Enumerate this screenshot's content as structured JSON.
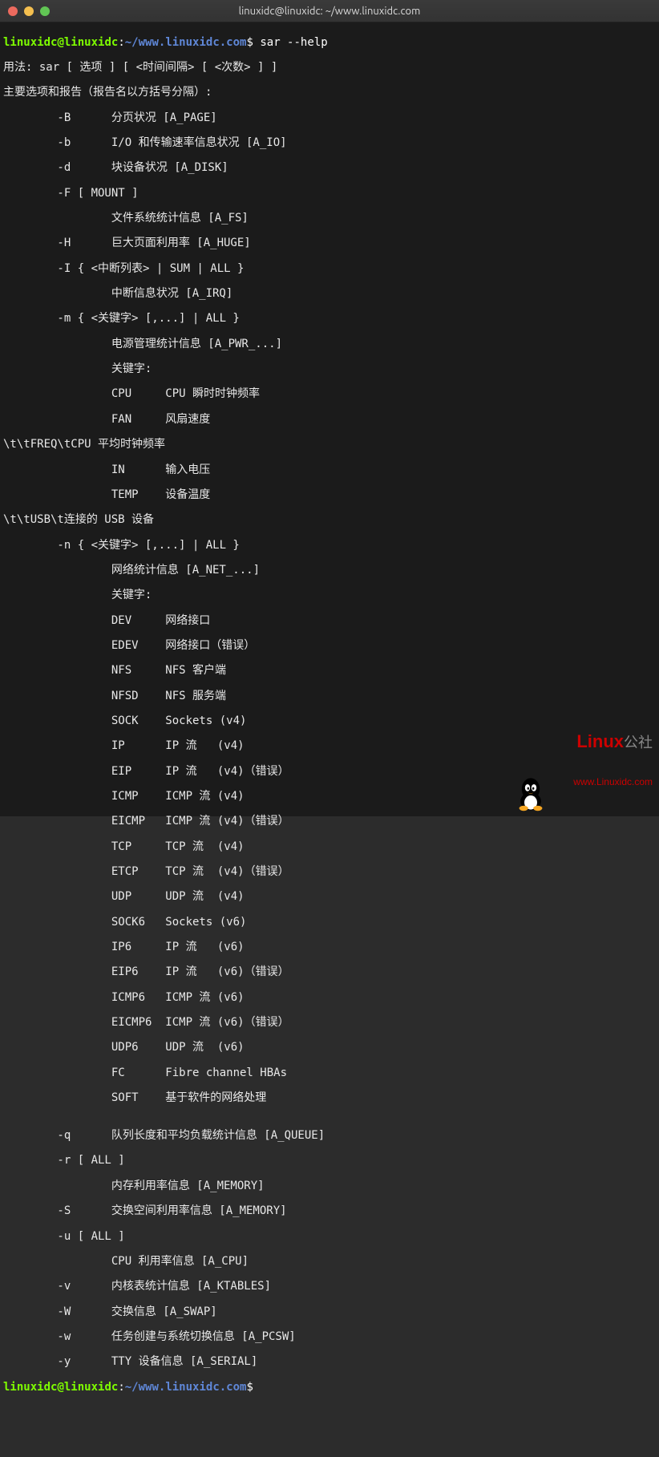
{
  "window": {
    "title": "linuxidc@linuxidc: ~/www.linuxidc.com"
  },
  "prompt": {
    "user": "linuxidc",
    "at": "@",
    "host": "linuxidc",
    "sep": ":",
    "path": "~/www.linuxidc.com",
    "dollar": "$",
    "command": "sar --help"
  },
  "out": {
    "usage": "用法: sar [ 选项 ] [ <时间间隔> [ <次数> ] ]",
    "main": "主要选项和报告（报告名以方括号分隔）:",
    "B": "        -B      分页状况 [A_PAGE]",
    "b": "        -b      I/O 和传输速率信息状况 [A_IO]",
    "d": "        -d      块设备状况 [A_DISK]",
    "F": "        -F [ MOUNT ]",
    "Ffs": "                文件系统统计信息 [A_FS]",
    "H": "        -H      巨大页面利用率 [A_HUGE]",
    "I": "        -I { <中断列表> | SUM | ALL }",
    "Iirq": "                中断信息状况 [A_IRQ]",
    "m": "        -m { <关键字> [,...] | ALL }",
    "mpwr": "                电源管理统计信息 [A_PWR_...]",
    "mkey": "                关键字:",
    "mcpu": "                CPU     CPU 瞬时时钟频率",
    "mfan": "                FAN     风扇速度",
    "mfreq": "\\t\\tFREQ\\tCPU 平均时钟频率",
    "min": "                IN      输入电压",
    "mtemp": "                TEMP    设备温度",
    "musb": "\\t\\tUSB\\t连接的 USB 设备",
    "n": "        -n { <关键字> [,...] | ALL }",
    "nnet": "                网络统计信息 [A_NET_...]",
    "nkey": "                关键字:",
    "ndev": "                DEV     网络接口",
    "nedev": "                EDEV    网络接口（错误）",
    "nnfs": "                NFS     NFS 客户端",
    "nnfsd": "                NFSD    NFS 服务端",
    "nsock": "                SOCK    Sockets (v4)",
    "nip": "                IP      IP 流   (v4)",
    "neip": "                EIP     IP 流   (v4)（错误）",
    "nicmp": "                ICMP    ICMP 流 (v4)",
    "neicmp": "                EICMP   ICMP 流 (v4)（错误）",
    "ntcp": "                TCP     TCP 流  (v4)",
    "netcp": "                ETCP    TCP 流  (v4)（错误）",
    "nudp": "                UDP     UDP 流  (v4)",
    "nsock6": "                SOCK6   Sockets (v6)",
    "nip6": "                IP6     IP 流   (v6)",
    "neip6": "                EIP6    IP 流   (v6)（错误）",
    "nicmp6": "                ICMP6   ICMP 流 (v6)",
    "neicmp6": "                EICMP6  ICMP 流 (v6)（错误）",
    "nudp6": "                UDP6    UDP 流  (v6)",
    "nfc": "                FC      Fibre channel HBAs",
    "nsoft": "                SOFT    基于软件的网络处理",
    "blank1": "",
    "q": "        -q      队列长度和平均负载统计信息 [A_QUEUE]",
    "r": "        -r [ ALL ]",
    "rmem": "                内存利用率信息 [A_MEMORY]",
    "S": "        -S      交换空间利用率信息 [A_MEMORY]",
    "u": "        -u [ ALL ]",
    "ucpu": "                CPU 利用率信息 [A_CPU]",
    "v": "        -v      内核表统计信息 [A_KTABLES]",
    "W": "        -W      交换信息 [A_SWAP]",
    "w": "        -w      任务创建与系统切换信息 [A_PCSW]",
    "y": "        -y      TTY 设备信息 [A_SERIAL]"
  },
  "watermark": {
    "brand_main": "Linux",
    "brand_suffix": "公社",
    "url": "www.Linuxidc.com"
  }
}
